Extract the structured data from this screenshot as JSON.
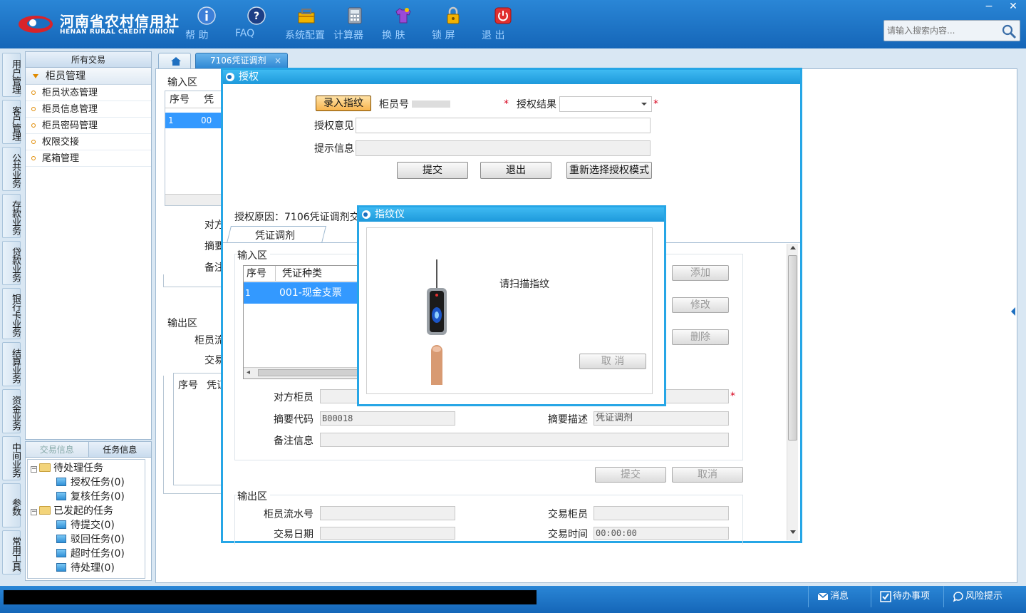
{
  "header": {
    "logo_cn": "河南省农村信用社",
    "logo_en": "HENAN RURAL CREDIT UNION",
    "tools": [
      {
        "label": "帮 助",
        "icon": "info-icon"
      },
      {
        "label": "FAQ",
        "icon": "question-icon"
      },
      {
        "label": "系统配置",
        "icon": "toolbox-icon"
      },
      {
        "label": "计算器",
        "icon": "calculator-icon"
      },
      {
        "label": "换 肤",
        "icon": "tshirt-icon"
      },
      {
        "label": "锁 屏",
        "icon": "lock-icon"
      },
      {
        "label": "退 出",
        "icon": "power-icon"
      }
    ],
    "search_placeholder": "请输入搜索内容...",
    "minimize": "−",
    "close": "✕"
  },
  "vtabs": [
    "用户管理",
    "客户管理",
    "公共业务",
    "存款业务",
    "贷款业务",
    "银行卡业务",
    "结算业务",
    "资金业务",
    "中间业务",
    "参数",
    "常用工具"
  ],
  "leftpanel": {
    "header": "所有交易",
    "group": "柜员管理",
    "items": [
      "柜员状态管理",
      "柜员信息管理",
      "柜员密码管理",
      "权限交接",
      "尾箱管理"
    ]
  },
  "taskpanel": {
    "tab_trade": "交易信息",
    "tab_task": "任务信息",
    "tree": {
      "pending": "待处理任务",
      "auth": "授权任务(0)",
      "review": "复核任务(0)",
      "initiated": "已发起的任务",
      "to_submit": "待提交(0)",
      "rejected": "驳回任务(0)",
      "timeout": "超时任务(0)",
      "to_process": "待处理(0)"
    }
  },
  "tabs": {
    "active": "7106凭证调剂",
    "close": "×"
  },
  "main_bg": {
    "input_area": "输入区",
    "col_seq": "序号",
    "col_voucher_short": "凭",
    "row_seq": "1",
    "row_code_short": "00",
    "counter_short": "对方",
    "summary_short": "摘要",
    "remark_short": "备注",
    "output_area": "输出区",
    "teller_flow_short": "柜员流",
    "trade_short": "交易",
    "col_voucher_out": "凭证"
  },
  "auth_dialog": {
    "title": "授权",
    "fingerprint_btn": "录入指纹",
    "teller_no_label": "柜员号",
    "auth_result_label": "授权结果",
    "auth_opinion_label": "授权意见",
    "hint_label": "提示信息",
    "submit": "提交",
    "exit": "退出",
    "reselect": "重新选择授权模式",
    "reason": "授权原因：7106凭证调剂交",
    "subtab": "凭证调剂",
    "input_area": "输入区",
    "col_seq": "序号",
    "col_type": "凭证种类",
    "row_seq": "1",
    "row_type": "001-现金支票",
    "add": "添加",
    "modify": "修改",
    "delete": "删除",
    "counter_teller": "对方柜员",
    "summary_code": "摘要代码",
    "summary_code_val": "B00018",
    "summary_desc": "摘要描述",
    "summary_desc_val": "凭证调剂",
    "remark": "备注信息",
    "submit2": "提交",
    "cancel2": "取消",
    "output_area": "输出区",
    "teller_flow": "柜员流水号",
    "trade_teller": "交易柜员",
    "trade_date": "交易日期",
    "trade_time": "交易时间",
    "trade_time_val": "00:00:00"
  },
  "fp_dialog": {
    "title": "指纹仪",
    "prompt": "请扫描指纹",
    "cancel": "取 消"
  },
  "footer": {
    "messages": "消息",
    "todo": "待办事项",
    "risk": "风险提示"
  }
}
